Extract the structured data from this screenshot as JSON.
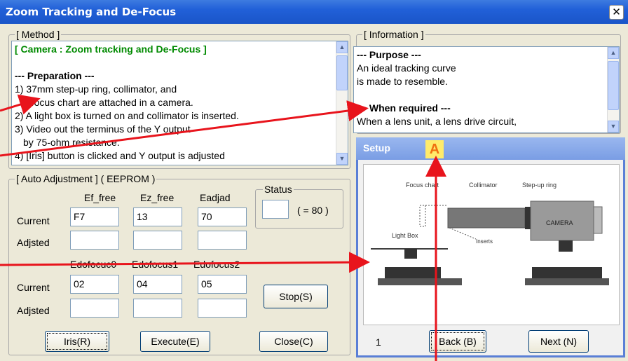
{
  "window": {
    "title": "Zoom Tracking and De-Focus",
    "close_glyph": "✕"
  },
  "method": {
    "title": "[ Method ]",
    "lines": [
      "[ Camera : Zoom tracking and De-Focus ]",
      "",
      "--- Preparation ---",
      "1) 37mm step-up ring, collimator, and",
      "   a focus chart are attached in a camera.",
      "2) A light box is turned on and collimator is inserted.",
      "3) Video out the terminus of the Y output",
      "   by 75-ohm resistance.",
      "4)  [Iris] button is clicked and Y output is adjusted"
    ]
  },
  "information": {
    "title": "[ Information ]",
    "lines": [
      "--- Purpose ---",
      "An ideal tracking curve",
      "is made to resemble.",
      "",
      "--- When required ---",
      "When a lens unit, a lens drive circuit,"
    ]
  },
  "auto_adjustment": {
    "title": "[ Auto Adjustment ] ( EEPROM )",
    "col_headers_1": [
      "Ef_free",
      "Ez_free",
      "Eadjad"
    ],
    "col_headers_2": [
      "Edofocuc0",
      "Edofocus1",
      "Edofocus2"
    ],
    "row_labels": {
      "current": "Current",
      "adjusted": "Adjsted"
    },
    "current_1": [
      "F7",
      "13",
      "70"
    ],
    "adjusted_1": [
      "",
      "",
      ""
    ],
    "current_2": [
      "02",
      "04",
      "05"
    ],
    "adjusted_2": [
      "",
      "",
      ""
    ],
    "status": {
      "label": "Status",
      "value": "",
      "hint": "( = 80 )"
    }
  },
  "buttons": {
    "stop": "Stop(S)",
    "iris": "Iris(R)",
    "execute": "Execute(E)",
    "close": "Close(C)"
  },
  "setup": {
    "title": "Setup",
    "marker": "A",
    "page": "1",
    "back": "Back (B)",
    "next": "Next (N)",
    "diagram_labels": {
      "focus_chart": "Focus chart",
      "collimator": "Collimator",
      "stepup_ring": "Step-up ring",
      "camera": "CAMERA",
      "light_box": "Light Box",
      "inserts": "Inserts"
    }
  },
  "colors": {
    "arrow": "#e8141c",
    "marker_bg": "#ffeb6b",
    "marker_text": "#f07010"
  }
}
